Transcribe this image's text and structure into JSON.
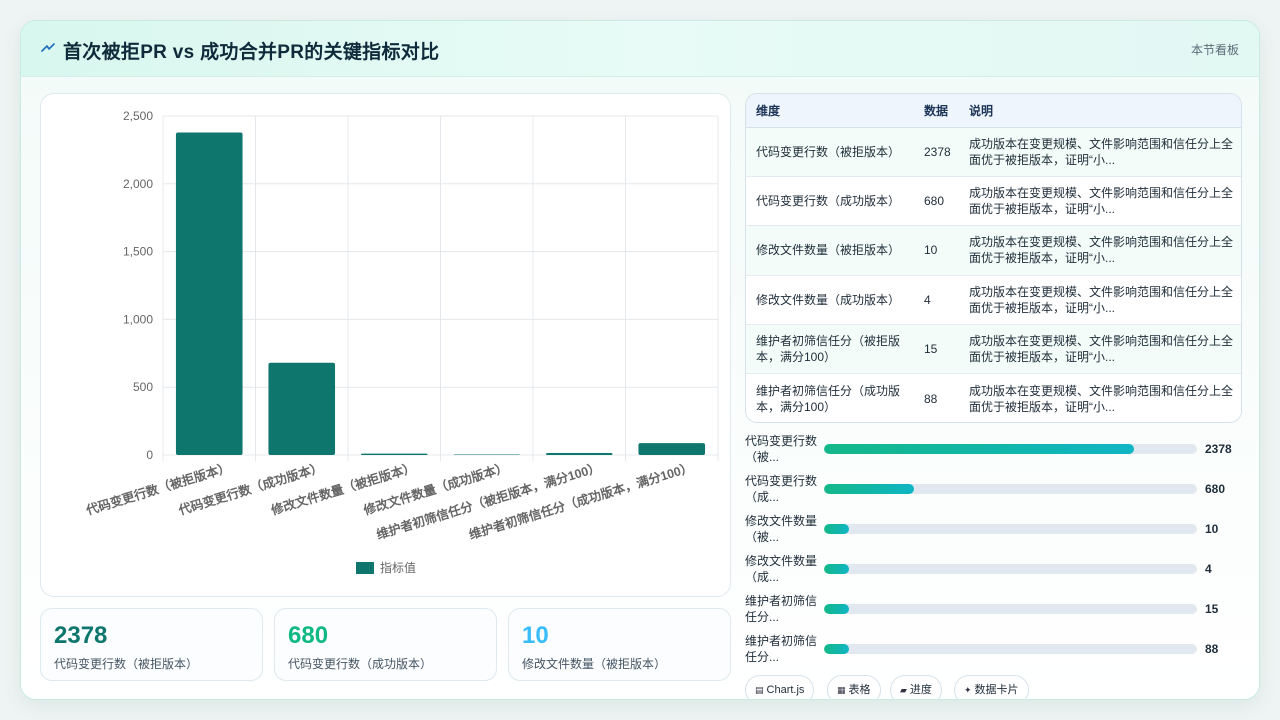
{
  "header": {
    "title": "首次被拒PR vs 成功合并PR的关键指标对比",
    "subtitle": "本节看板"
  },
  "colors": {
    "bar": "#0f766e",
    "accent_dark": "#0f766e",
    "accent_green": "#10b981",
    "accent_blue": "#38bdf8"
  },
  "chart_data": {
    "type": "bar",
    "categories": [
      "代码变更行数（被拒版本）",
      "代码变更行数（成功版本）",
      "修改文件数量（被拒版本）",
      "修改文件数量（成功版本）",
      "维护者初筛信任分（被拒版本，满分100）",
      "维护者初筛信任分（成功版本，满分100）"
    ],
    "series": [
      {
        "name": "指标值",
        "values": [
          2378,
          680,
          10,
          4,
          15,
          88
        ]
      }
    ],
    "ylim": [
      0,
      2500
    ],
    "yticks": [
      "0",
      "500",
      "1,000",
      "1,500",
      "2,000",
      "2,500"
    ],
    "legend": "bottom",
    "grid": true
  },
  "stats": [
    {
      "value": "2378",
      "label": "代码变更行数（被拒版本）"
    },
    {
      "value": "680",
      "label": "代码变更行数（成功版本）"
    },
    {
      "value": "10",
      "label": "修改文件数量（被拒版本）"
    }
  ],
  "table": {
    "headers": [
      "维度",
      "数据",
      "说明"
    ],
    "rows": [
      {
        "dim": "代码变更行数（被拒版本）",
        "val": "2378",
        "desc": "成功版本在变更规模、文件影响范围和信任分上全面优于被拒版本，证明“小..."
      },
      {
        "dim": "代码变更行数（成功版本）",
        "val": "680",
        "desc": "成功版本在变更规模、文件影响范围和信任分上全面优于被拒版本，证明“小..."
      },
      {
        "dim": "修改文件数量（被拒版本）",
        "val": "10",
        "desc": "成功版本在变更规模、文件影响范围和信任分上全面优于被拒版本，证明“小..."
      },
      {
        "dim": "修改文件数量（成功版本）",
        "val": "4",
        "desc": "成功版本在变更规模、文件影响范围和信任分上全面优于被拒版本，证明“小..."
      },
      {
        "dim": "维护者初筛信任分（被拒版本，满分100）",
        "val": "15",
        "desc": "成功版本在变更规模、文件影响范围和信任分上全面优于被拒版本，证明“小..."
      },
      {
        "dim": "维护者初筛信任分（成功版本，满分100）",
        "val": "88",
        "desc": "成功版本在变更规模、文件影响范围和信任分上全面优于被拒版本，证明“小..."
      }
    ]
  },
  "progress": [
    {
      "label": "代码变更行数（被...",
      "value": "2378",
      "fraction": 0.83
    },
    {
      "label": "代码变更行数（成...",
      "value": "680",
      "fraction": 0.24
    },
    {
      "label": "修改文件数量（被...",
      "value": "10",
      "fraction": 0.066
    },
    {
      "label": "修改文件数量（成...",
      "value": "4",
      "fraction": 0.066
    },
    {
      "label": "维护者初筛信任分...",
      "value": "15",
      "fraction": 0.066
    },
    {
      "label": "维护者初筛信任分...",
      "value": "88",
      "fraction": 0.066
    }
  ],
  "tags": [
    {
      "icon": "chart-icon",
      "label": "Chart.js"
    },
    {
      "icon": "table-icon",
      "label": "表格"
    },
    {
      "icon": "progress-icon",
      "label": "进度"
    },
    {
      "icon": "sparkle-icon",
      "label": "数据卡片"
    }
  ]
}
